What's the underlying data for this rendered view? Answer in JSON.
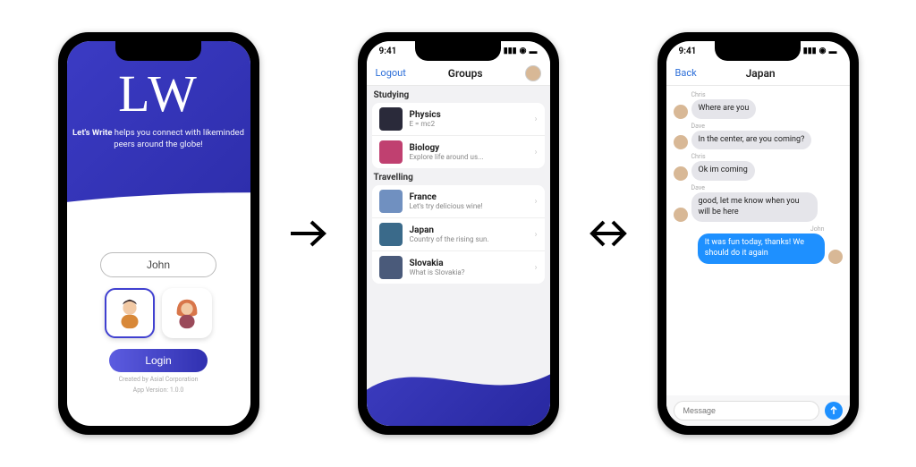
{
  "status": {
    "time": "9:41"
  },
  "phone1": {
    "logo": "LW",
    "brand": "Let's Write",
    "tagline_rest": " helps you connect with likeminded peers around the globe!",
    "name_value": "John",
    "login_label": "Login",
    "created_by": "Created by Asial Corporation",
    "version": "App Version: 1.0.0"
  },
  "phone2": {
    "logout": "Logout",
    "title": "Groups",
    "sections": [
      {
        "header": "Studying",
        "items": [
          {
            "title": "Physics",
            "sub": "E = mc2",
            "color": "#2a2a3a"
          },
          {
            "title": "Biology",
            "sub": "Explore life around us...",
            "color": "#c04070"
          }
        ]
      },
      {
        "header": "Travelling",
        "items": [
          {
            "title": "France",
            "sub": "Let's try delicious wine!",
            "color": "#7090c0"
          },
          {
            "title": "Japan",
            "sub": "Country of the rising sun.",
            "color": "#3a6a8a"
          },
          {
            "title": "Slovakia",
            "sub": "What is Slovakia?",
            "color": "#4a5a7a"
          }
        ]
      }
    ]
  },
  "phone3": {
    "back": "Back",
    "title": "Japan",
    "messages": [
      {
        "name": "Chris",
        "text": "Where are you",
        "side": "left"
      },
      {
        "name": "Dave",
        "text": "In the center, are you coming?",
        "side": "left"
      },
      {
        "name": "Chris",
        "text": "Ok im coming",
        "side": "left"
      },
      {
        "name": "Dave",
        "text": "good, let me know when you will be here",
        "side": "left"
      },
      {
        "name": "John",
        "text": "It was fun today, thanks! We should do it again",
        "side": "right"
      }
    ],
    "input_placeholder": "Message"
  }
}
